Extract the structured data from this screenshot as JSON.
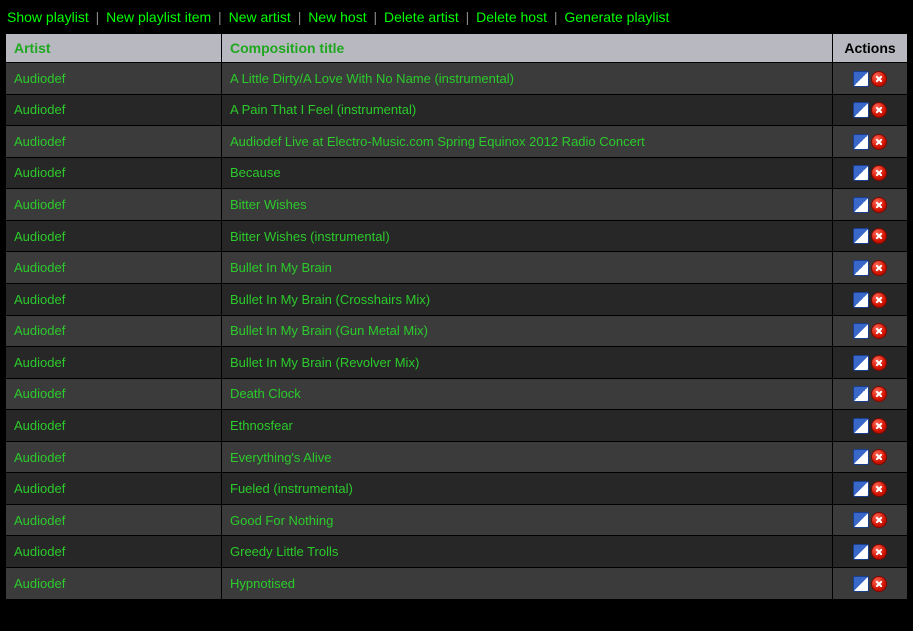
{
  "nav": {
    "show_playlist": "Show playlist",
    "new_playlist_item": "New playlist item",
    "new_artist": "New artist",
    "new_host": "New host",
    "delete_artist": "Delete artist",
    "delete_host": "Delete host",
    "generate_playlist": "Generate playlist",
    "sep": "|"
  },
  "table": {
    "headers": {
      "artist": "Artist",
      "title": "Composition title",
      "actions": "Actions"
    },
    "rows": [
      {
        "artist": "Audiodef",
        "title": "A Little Dirty/A Love With No Name (instrumental)"
      },
      {
        "artist": "Audiodef",
        "title": "A Pain That I Feel (instrumental)"
      },
      {
        "artist": "Audiodef",
        "title": "Audiodef Live at Electro-Music.com Spring Equinox 2012 Radio Concert"
      },
      {
        "artist": "Audiodef",
        "title": "Because"
      },
      {
        "artist": "Audiodef",
        "title": "Bitter Wishes"
      },
      {
        "artist": "Audiodef",
        "title": "Bitter Wishes (instrumental)"
      },
      {
        "artist": "Audiodef",
        "title": "Bullet In My Brain"
      },
      {
        "artist": "Audiodef",
        "title": "Bullet In My Brain (Crosshairs Mix)"
      },
      {
        "artist": "Audiodef",
        "title": "Bullet In My Brain (Gun Metal Mix)"
      },
      {
        "artist": "Audiodef",
        "title": "Bullet In My Brain (Revolver Mix)"
      },
      {
        "artist": "Audiodef",
        "title": "Death Clock"
      },
      {
        "artist": "Audiodef",
        "title": "Ethnosfear"
      },
      {
        "artist": "Audiodef",
        "title": "Everything's Alive"
      },
      {
        "artist": "Audiodef",
        "title": "Fueled (instrumental)"
      },
      {
        "artist": "Audiodef",
        "title": "Good For Nothing"
      },
      {
        "artist": "Audiodef",
        "title": "Greedy Little Trolls"
      },
      {
        "artist": "Audiodef",
        "title": "Hypnotised"
      }
    ]
  }
}
